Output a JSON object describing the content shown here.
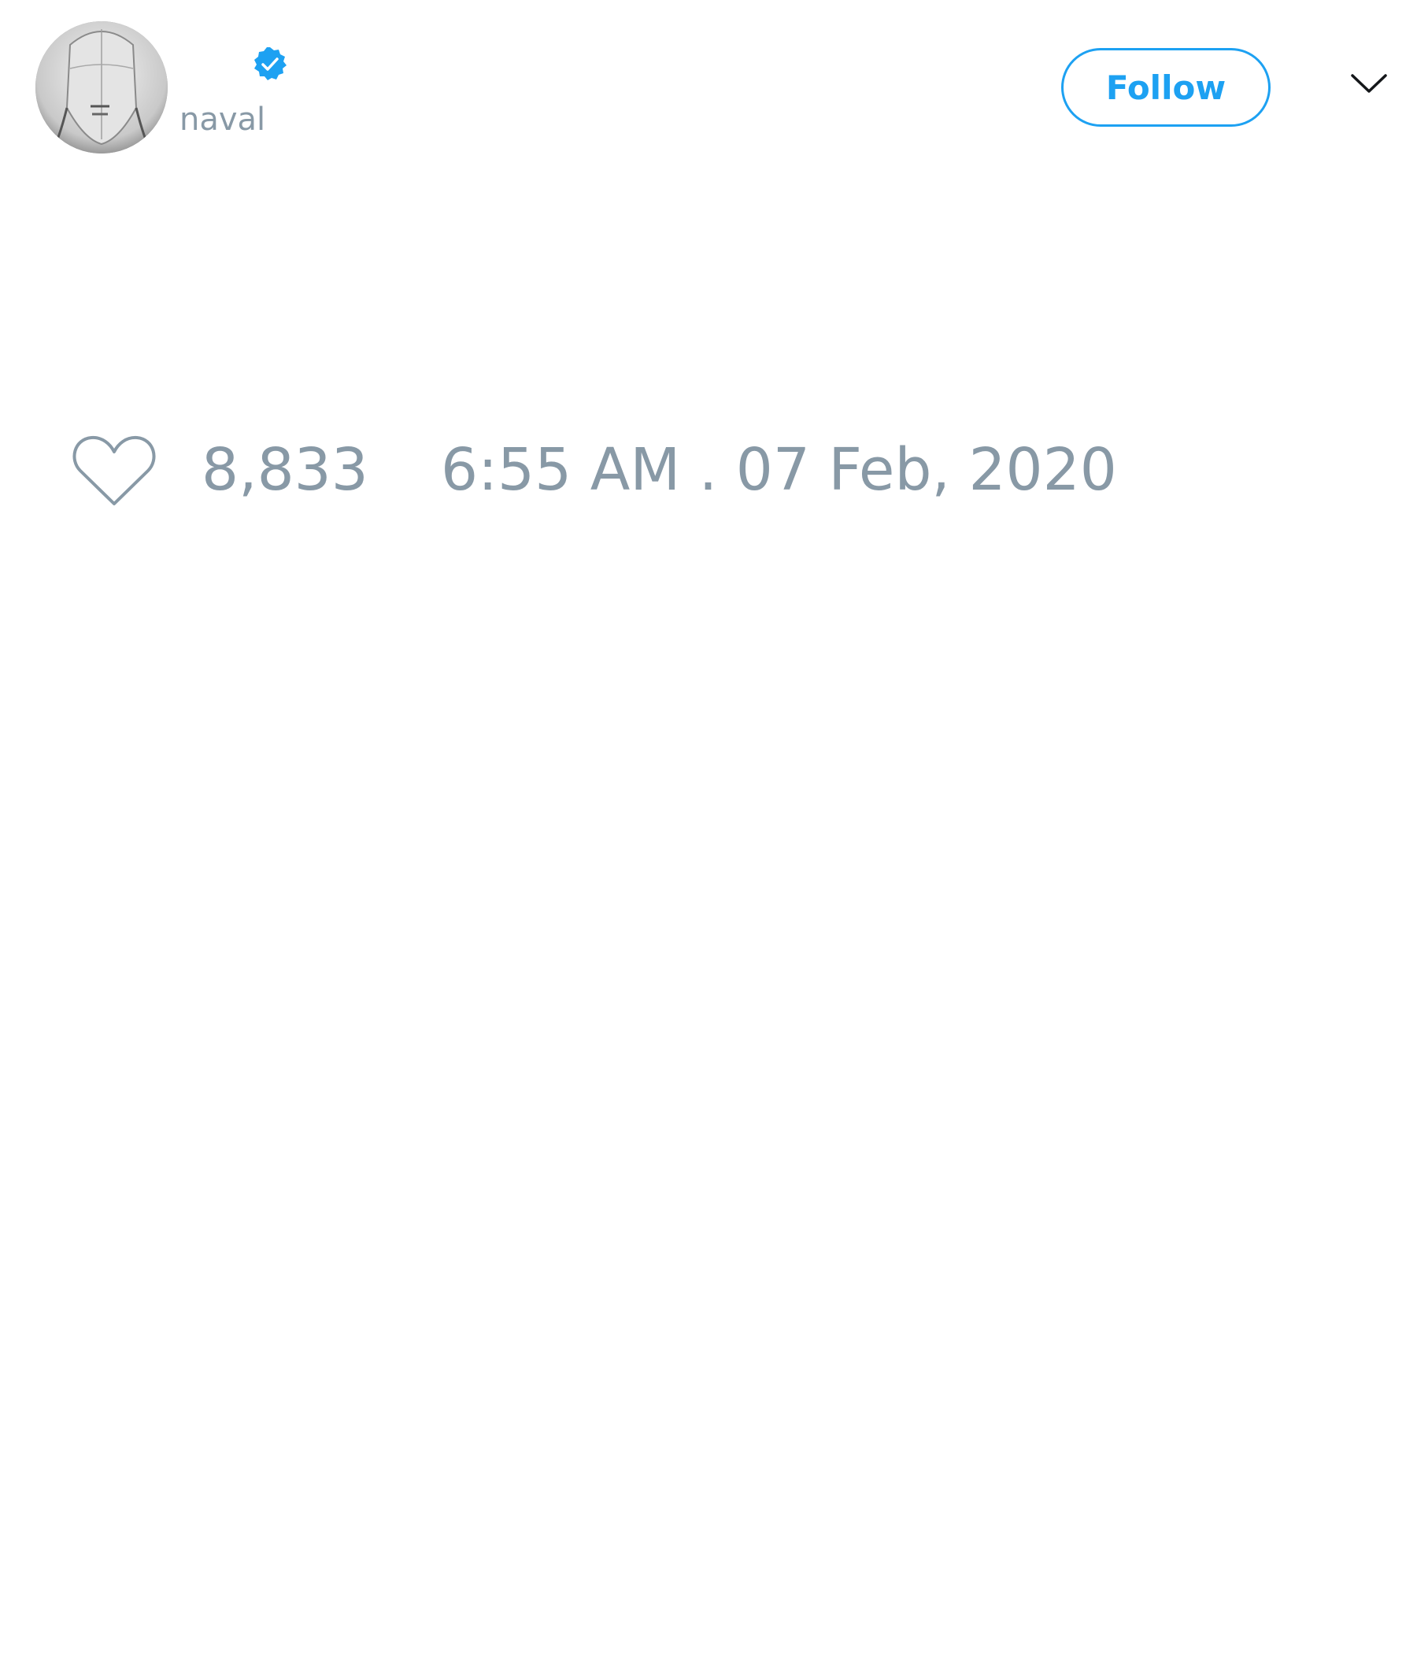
{
  "tweet": {
    "author": {
      "display_name": "",
      "handle": "naval",
      "verified": true,
      "avatar_icon": "avatar-portrait-sketch"
    },
    "follow_label": "Follow",
    "menu_icon": "chevron-down-icon",
    "likes": {
      "icon": "heart-outline-icon",
      "count": "8,833"
    },
    "timestamp": "6:55 AM . 07 Feb, 2020"
  },
  "colors": {
    "accent": "#1da1f2",
    "muted_text": "#8899a6",
    "background": "#ffffff"
  }
}
